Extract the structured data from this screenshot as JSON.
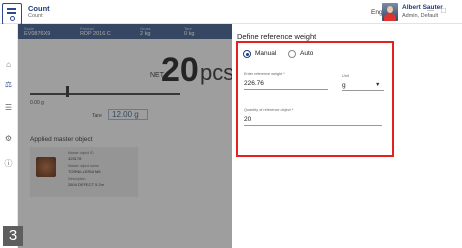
{
  "header": {
    "app_title": "Count",
    "app_subtitle": "Count",
    "language": "English",
    "user_name": "Albert Sauter",
    "user_role": "Admin, Default"
  },
  "weigh_bar": {
    "items": [
      {
        "label": "Scale",
        "value": "EV0876X9"
      },
      {
        "label": "Product",
        "value": "RDP 2016 C"
      },
      {
        "label": "Gross",
        "value": "2 kg"
      },
      {
        "label": "Tare",
        "value": "0 kg"
      }
    ]
  },
  "main": {
    "net_label": "NET",
    "weight_value": "20",
    "weight_unit": "pcs",
    "scale_min": "0.00 g",
    "tare_label": "Tare",
    "tare_value": "12.00 g",
    "applied_title": "Applied master object",
    "applied": {
      "id_label": "Master object ID",
      "id_value": "425178",
      "name_label": "Master object name",
      "name_value": "TORNILLERIA M6",
      "desc_label": "Description",
      "desc_value": "2604 DEFECT 5.2m"
    }
  },
  "panel": {
    "title": "Define reference weight",
    "mode_manual": "Manual",
    "mode_auto": "Auto",
    "selected_mode": "Manual",
    "ref_weight_label": "Enter reference weight *",
    "ref_weight_value": "226.76",
    "unit_label": "Unit",
    "unit_value": "g",
    "qty_label": "Quantity of reference object *",
    "qty_value": "20"
  },
  "step_badge": "3",
  "colors": {
    "brand": "#1f3d7a",
    "highlight": "#e2221f",
    "weigh_bar": "#3f5d8c"
  },
  "icons": {
    "close": "close-icon",
    "minimize": "minimize-icon",
    "dropdown": "chevron-down-icon"
  }
}
